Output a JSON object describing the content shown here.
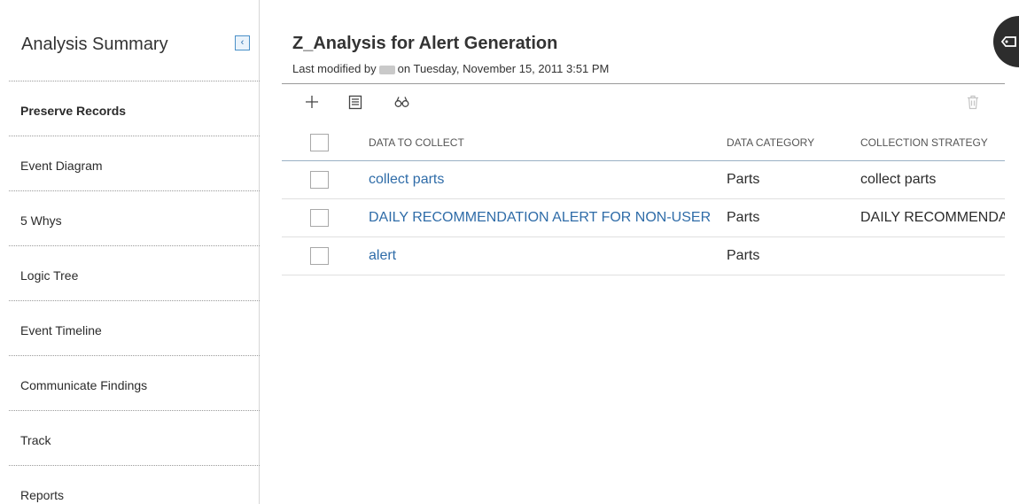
{
  "sidebar": {
    "title": "Analysis Summary",
    "collapse_icon": "chevron-left-icon",
    "items": [
      {
        "label": "Preserve Records",
        "active": true
      },
      {
        "label": "Event Diagram",
        "active": false
      },
      {
        "label": "5 Whys",
        "active": false
      },
      {
        "label": "Logic Tree",
        "active": false
      },
      {
        "label": "Event Timeline",
        "active": false
      },
      {
        "label": "Communicate Findings",
        "active": false
      },
      {
        "label": "Track",
        "active": false
      },
      {
        "label": "Reports",
        "active": false
      }
    ]
  },
  "header": {
    "title": "Z_Analysis for Alert Generation",
    "modified_prefix": "Last modified by",
    "modified_suffix": "on Tuesday, November 15, 2011 3:51 PM"
  },
  "toolbar": {
    "add_icon": "plus-icon",
    "details_icon": "list-document-icon",
    "find_icon": "binoculars-icon",
    "delete_icon": "trash-icon"
  },
  "grid": {
    "columns": [
      "DATA TO COLLECT",
      "DATA CATEGORY",
      "COLLECTION STRATEGY"
    ],
    "rows": [
      {
        "data": "collect parts",
        "category": "Parts",
        "strategy": "collect parts"
      },
      {
        "data": "DAILY RECOMMENDATION ALERT FOR NON-USER",
        "category": "Parts",
        "strategy": "DAILY RECOMMENDA"
      },
      {
        "data": "alert",
        "category": "Parts",
        "strategy": ""
      }
    ]
  },
  "floating_button": {
    "icon": "expand-tag-icon"
  },
  "colors": {
    "link": "#2f6ca8",
    "accent": "#4a90c8",
    "float_bg": "#2d2d2d"
  }
}
